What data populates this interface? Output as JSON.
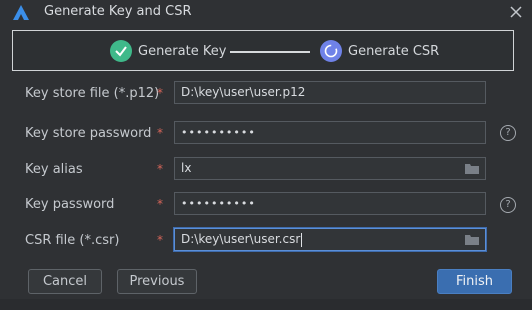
{
  "window": {
    "title": "Generate Key and CSR",
    "accent": "#3a6eb0"
  },
  "steps": [
    {
      "label": "Generate Key",
      "status": "done",
      "color": "#3fb98a"
    },
    {
      "label": "Generate CSR",
      "status": "current",
      "color": "#6f82e8"
    }
  ],
  "form": {
    "key_store_file": {
      "label": "Key store file (*.p12)",
      "value": "D:\\key\\user\\user.p12"
    },
    "key_store_password": {
      "label": "Key store password",
      "value": "••••••••••"
    },
    "key_alias": {
      "label": "Key alias",
      "value": "lx"
    },
    "key_password": {
      "label": "Key password",
      "value": "••••••••••"
    },
    "csr_file": {
      "label": "CSR file (*.csr)",
      "value": "D:\\key\\user\\user.csr"
    }
  },
  "required_mark": "*",
  "buttons": {
    "cancel": "Cancel",
    "previous": "Previous",
    "finish": "Finish"
  }
}
